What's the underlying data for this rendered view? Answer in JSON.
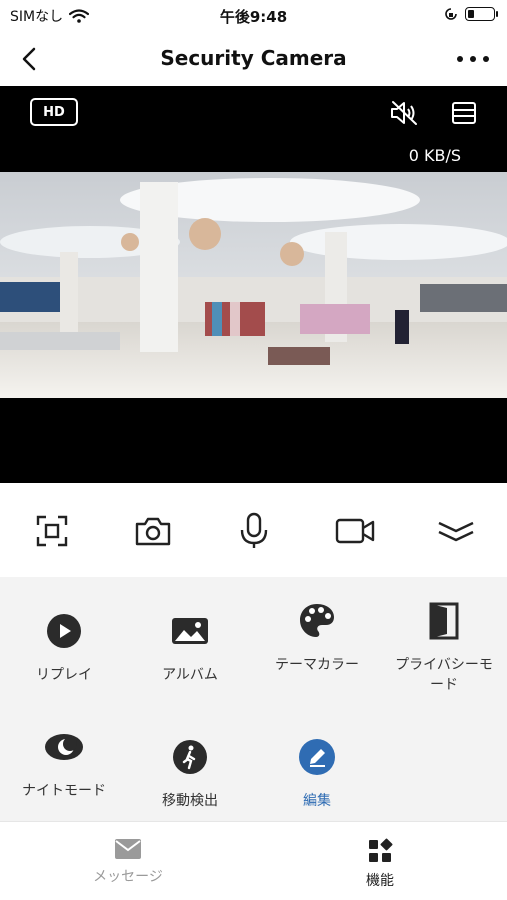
{
  "status_bar": {
    "carrier": "SIMなし",
    "time": "午後9:48",
    "battery_level": 0.25
  },
  "nav": {
    "title": "Security Camera"
  },
  "video": {
    "quality_badge": "HD",
    "data_rate": "0 KB/S"
  },
  "controls": [
    {
      "icon": "fullscreen-icon"
    },
    {
      "icon": "camera-icon"
    },
    {
      "icon": "microphone-icon"
    },
    {
      "icon": "video-record-icon"
    },
    {
      "icon": "collapse-chevron-icon"
    }
  ],
  "functions": [
    {
      "label": "リプレイ",
      "icon": "play-circle-icon"
    },
    {
      "label": "アルバム",
      "icon": "image-icon"
    },
    {
      "label": "テーマカラー",
      "icon": "palette-icon"
    },
    {
      "label": "プライバシーモード",
      "icon": "privacy-shield-icon"
    },
    {
      "label": "ナイトモード",
      "icon": "moon-icon"
    },
    {
      "label": "移動検出",
      "icon": "walking-person-icon"
    },
    {
      "label": "編集",
      "icon": "edit-pencil-icon",
      "color": "#2f6cb3"
    }
  ],
  "tabs": [
    {
      "label": "メッセージ",
      "icon": "mail-icon",
      "color": "#9a9a9a"
    },
    {
      "label": "機能",
      "icon": "grid-icon",
      "color": "#222222"
    }
  ]
}
